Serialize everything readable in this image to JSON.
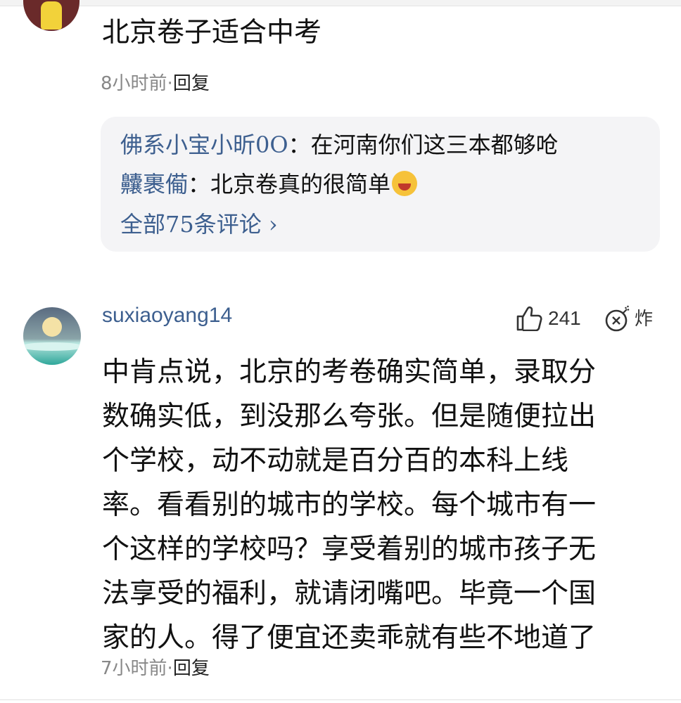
{
  "comment1": {
    "text": "北京卷子适合中考",
    "time": "8小时前",
    "sep": "·",
    "reply_label": "回复",
    "replies": [
      {
        "name": "佛系小宝小昕0O",
        "colon": "：",
        "text": "在河南你们这三本都够呛"
      },
      {
        "name": "齉裹僃",
        "colon": "：",
        "text": "北京卷真的很简单"
      }
    ],
    "all_comments": "全部75条评论 ›"
  },
  "comment2": {
    "username": "suxiaoyang14",
    "likes": "241",
    "bomb_label": "炸",
    "lines": [
      "中肯点说，北京的考卷确实简单，录取分",
      "数确实低，到没那么夸张。但是随便拉出",
      "个学校，动不动就是百分百的本科上线",
      "率。看看别的城市的学校。每个城市有一",
      "个这样的学校吗？享受着别的城市孩子无",
      "法享受的福利，就请闭嘴吧。毕竟一个国",
      "家的人。得了便宜还卖乖就有些不地道了"
    ],
    "time": "7小时前",
    "sep": "·",
    "reply_label": "回复"
  },
  "icons": {
    "like": "thumbs-up-icon",
    "bomb": "bomb-icon",
    "emoji": "laughing-crying-emoji"
  },
  "colors": {
    "name_link": "#3d5f8f",
    "meta": "#888888",
    "reply_bg": "#f4f4f6"
  }
}
